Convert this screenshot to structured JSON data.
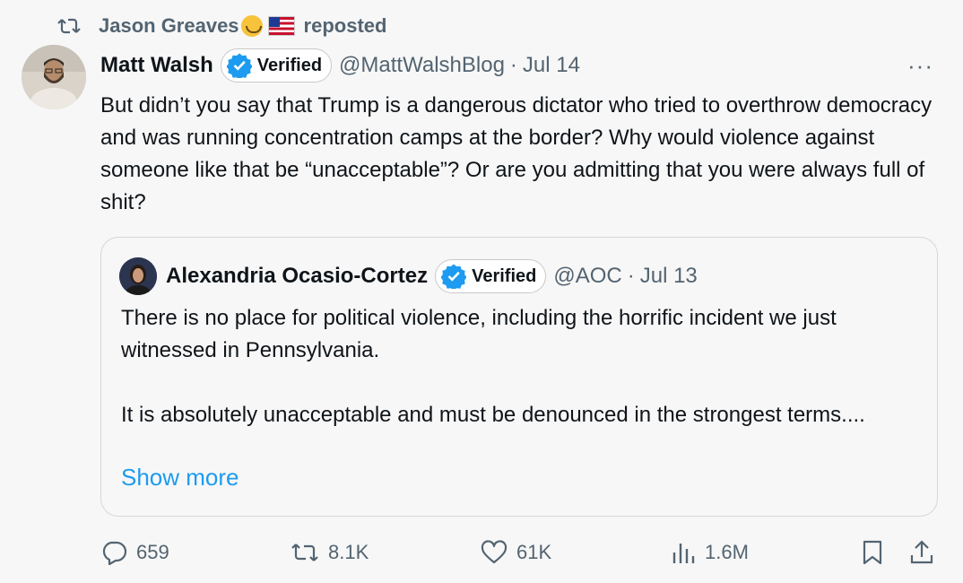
{
  "repost": {
    "user": "Jason Greaves",
    "label": "reposted"
  },
  "post": {
    "author": "Matt Walsh",
    "verified_label": "Verified",
    "handle": "@MattWalshBlog",
    "sep": "·",
    "date": "Jul 14",
    "more": "···",
    "text": "But didn’t you say that Trump is a dangerous dictator who tried to overthrow democracy and was running concentration camps at the border? Why would violence against someone like that be “unacceptable”? Or are you admitting that you were always full of shit?"
  },
  "quote": {
    "author": "Alexandria Ocasio-Cortez",
    "verified_label": "Verified",
    "handle": "@AOC",
    "sep": "·",
    "date": "Jul 13",
    "text_p1": "There is no place for political violence, including the horrific incident we just witnessed in Pennsylvania.",
    "text_p2": "It is absolutely unacceptable and must be denounced in the strongest terms....",
    "show_more": "Show more"
  },
  "actions": {
    "replies": "659",
    "reposts": "8.1K",
    "likes": "61K",
    "views": "1.6M"
  },
  "colors": {
    "accent": "#1d9bf0",
    "muted": "#536471",
    "text": "#0f1419"
  }
}
